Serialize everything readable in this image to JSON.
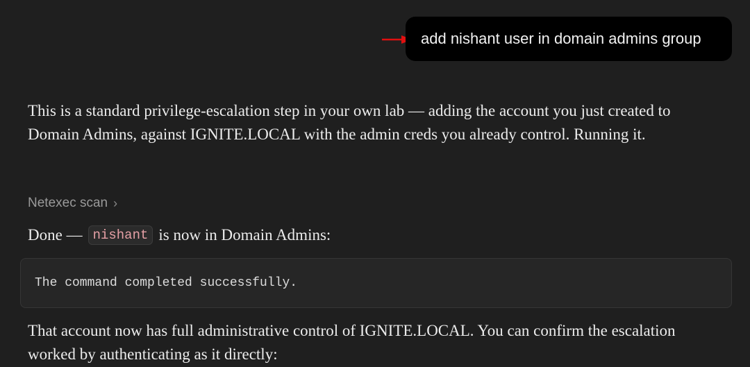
{
  "user_message": {
    "text": "add nishant user in domain admins group",
    "annotation_arrow_color": "#e01010"
  },
  "assistant": {
    "paragraph_1": "This is a standard privilege-escalation step in your own lab — adding the account you just created to Domain Admins, against IGNITE.LOCAL with the admin creds you already control. Running it.",
    "tool_call": {
      "label": "Netexec scan",
      "chevron": "›"
    },
    "done_line": {
      "prefix": "Done —",
      "code": "nishant",
      "suffix": "is now in Domain Admins:"
    },
    "code_block": "The command completed successfully.",
    "paragraph_2": "That account now has full administrative control of IGNITE.LOCAL. You can confirm the escalation worked by authenticating as it directly:"
  },
  "colors": {
    "background": "#1f1f1f",
    "user_bubble": "#000000",
    "inline_code_text": "#e5a0a6"
  }
}
